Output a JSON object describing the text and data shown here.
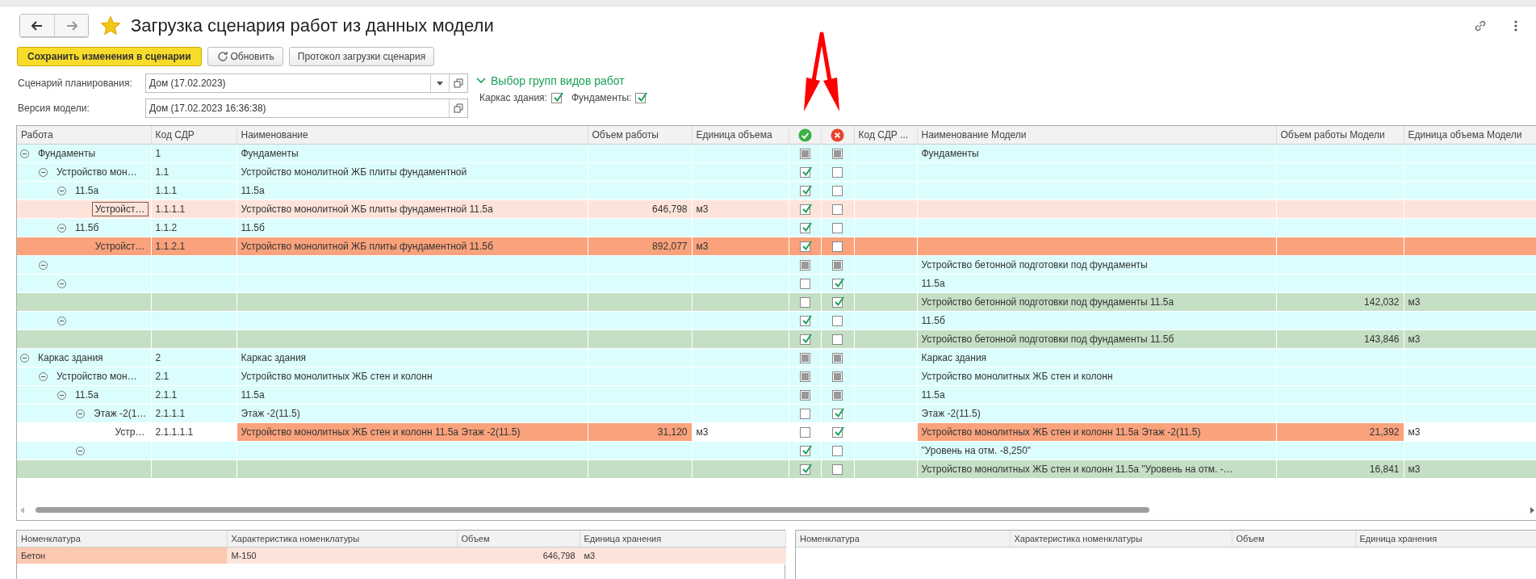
{
  "window": {
    "title": "Загрузка сценария работ из данных модели",
    "favorite": true
  },
  "toolbar": [
    {
      "label": "Сохранить изменения в сценарии",
      "kind": "primary"
    },
    {
      "label": "Обновить",
      "kind": "refresh"
    },
    {
      "label": "Протокол загрузки сценария",
      "kind": "plain"
    }
  ],
  "form": {
    "scenario": {
      "label": "Сценарий планирования:",
      "value": "Дом (17.02.2023)"
    },
    "version": {
      "label": "Версия модели:",
      "value": "Дом (17.02.2023 16:36:38)"
    },
    "groups": {
      "title": "Выбор групп видов работ",
      "expanded": true,
      "items": [
        {
          "label": "Каркас здания:",
          "checked": true
        },
        {
          "label": "Фундаменты:",
          "checked": true
        }
      ]
    }
  },
  "table": {
    "columns": [
      "Работа",
      "Код СДР",
      "Наименование",
      "Объем работы",
      "Единица объема",
      "",
      "",
      "Код СДР ...",
      "Наименование Модели",
      "Объем работы Модели",
      "Единица объема Модели"
    ],
    "rows": [
      {
        "kind": "group",
        "work": "Фундаменты",
        "code": "1",
        "name": "Фундаменты",
        "model_name": "Фундаменты",
        "color": "#dcfdfd",
        "selected": false,
        "expanded": true,
        "children": [
          {
            "kind": "item",
            "work": "Устройство мон…",
            "code": "1.1",
            "name": "Устройство монолитной ЖБ плиты фундаментной",
            "accept_checked": true,
            "reject_checked": false,
            "color": "#dcfdfd",
            "selected": false,
            "expanded": true,
            "children": [
              {
                "kind": "item",
                "work": "11.5а",
                "code": "1.1.1",
                "name": "11.5а",
                "accept_checked": true,
                "reject_checked": false,
                "color": "#dcfdfd",
                "selected": false,
                "expanded": true,
                "children": [
                  {
                    "kind": "item",
                    "work": "Устройст…",
                    "code": "1.1.1.1",
                    "name": "Устройство монолитной ЖБ плиты фундаментной 11.5а",
                    "volume": "646,798",
                    "unit": "м3",
                    "accept_checked": true,
                    "reject_checked": false,
                    "color": "#fde4da",
                    "selected": true
                  }
                ]
              },
              {
                "kind": "item",
                "work": "11.5б",
                "code": "1.1.2",
                "name": "11.5б",
                "accept_checked": true,
                "reject_checked": false,
                "color": "#dcfdfd",
                "selected": false,
                "expanded": true,
                "children": [
                  {
                    "kind": "item",
                    "work": "Устройст…",
                    "code": "1.1.2.1",
                    "name": "Устройство монолитной ЖБ плиты фундаментной 11.5б",
                    "volume": "892,077",
                    "unit": "м3",
                    "accept_checked": true,
                    "reject_checked": false,
                    "color": "#f9a27c",
                    "selected": false
                  }
                ]
              }
            ]
          },
          {
            "kind": "group",
            "model_name": "Устройство бетонной подготовки под фундаменты",
            "color": "#dcfdfd",
            "selected": false,
            "expanded": true,
            "children": [
              {
                "kind": "item",
                "accept_checked": false,
                "reject_checked": true,
                "model_name": "11.5а",
                "color": "#dcfdfd",
                "selected": false,
                "expanded": true,
                "children": [
                  {
                    "kind": "item",
                    "accept_checked": false,
                    "reject_checked": true,
                    "model_name": "Устройство бетонной подготовки под фундаменты 11.5а",
                    "model_volume": "142,032",
                    "model_unit": "м3",
                    "color": "#c5dfc4",
                    "selected": false
                  }
                ]
              },
              {
                "kind": "item",
                "accept_checked": true,
                "reject_checked": false,
                "model_name": "11.5б",
                "color": "#dcfdfd",
                "selected": false,
                "expanded": true,
                "children": [
                  {
                    "kind": "item",
                    "accept_checked": true,
                    "reject_checked": false,
                    "model_name": "Устройство бетонной подготовки под фундаменты 11.5б",
                    "model_volume": "143,846",
                    "model_unit": "м3",
                    "color": "#c5dfc4",
                    "selected": false
                  }
                ]
              }
            ]
          }
        ]
      },
      {
        "kind": "group",
        "work": "Каркас здания",
        "code": "2",
        "name": "Каркас здания",
        "model_name": "Каркас здания",
        "color": "#dcfdfd",
        "selected": false,
        "expanded": true,
        "children": [
          {
            "kind": "group",
            "work": "Устройство мон…",
            "code": "2.1",
            "name": "Устройство монолитных ЖБ стен и колонн",
            "model_name": "Устройство монолитных ЖБ стен и колонн",
            "color": "#dcfdfd",
            "selected": false,
            "expanded": true,
            "children": [
              {
                "kind": "group",
                "work": "11.5а",
                "code": "2.1.1",
                "name": "11.5а",
                "model_name": "11.5а",
                "color": "#dcfdfd",
                "selected": false,
                "expanded": true,
                "children": [
                  {
                    "kind": "item",
                    "work": "Этаж -2(1…",
                    "code": "2.1.1.1",
                    "name": "Этаж -2(11.5)",
                    "accept_checked": false,
                    "reject_checked": true,
                    "model_name": "Этаж -2(11.5)",
                    "color": "#dcfdfd",
                    "selected": false,
                    "expanded": true,
                    "children": [
                      {
                        "kind": "item",
                        "work": "Устр…",
                        "code": "2.1.1.1.1",
                        "name": "Устройство монолитных ЖБ стен и колонн 11.5а Этаж -2(11.5)",
                        "volume": "31,120",
                        "unit": "м3",
                        "accept_checked": false,
                        "reject_checked": true,
                        "model_name": "Устройство монолитных ЖБ стен и колонн 11.5а Этаж -2(11.5)",
                        "model_volume": "21,392",
                        "model_unit": "м3",
                        "color": "#ffffff",
                        "marked": {
                          "color": "#f9a27c"
                        },
                        "selected": false
                      }
                    ]
                  },
                  {
                    "kind": "item",
                    "accept_checked": true,
                    "reject_checked": false,
                    "model_name": "\"Уровень на отм. -8,250\"",
                    "color": "#dcfdfd",
                    "selected": false,
                    "expanded": true,
                    "children": [
                      {
                        "kind": "item",
                        "accept_checked": true,
                        "reject_checked": false,
                        "model_name": "Устройство монолитных ЖБ стен и колонн 11.5а \"Уровень на отм. -…",
                        "model_volume": "16,841",
                        "model_unit": "м3",
                        "color": "#c5dfc4",
                        "selected": false
                      }
                    ]
                  }
                ]
              }
            ]
          }
        ]
      }
    ]
  },
  "materials": {
    "columns": [
      "Номенклатура",
      "Характеристика номенклатуры",
      "Объем",
      "Единица хранения"
    ],
    "rows": [
      {
        "cells": [
          "Бетон",
          "М-150",
          "646,798",
          "м3"
        ],
        "color": "#fde4da",
        "first_cell": {
          "color": "#fbc8b0"
        }
      }
    ]
  },
  "model_materials": {
    "columns": [
      "Номенклатура",
      "Характеристика номенклатуры",
      "Объем",
      "Единица хранения"
    ]
  }
}
